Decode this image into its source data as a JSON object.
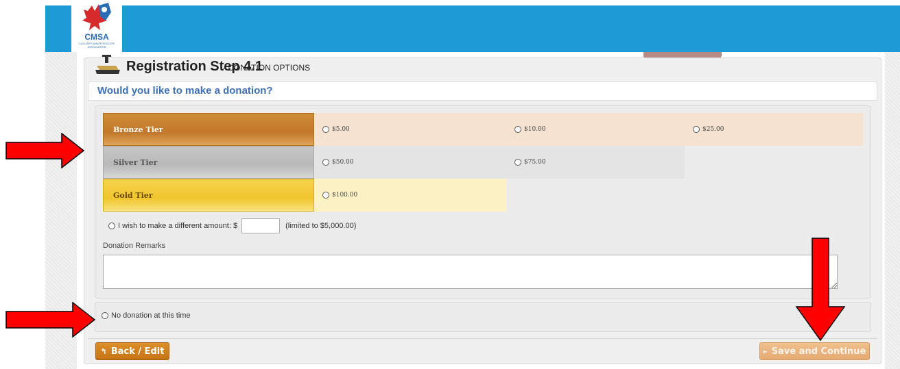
{
  "logo": {
    "name": "CMSA",
    "tagline": "CALGARY MINOR SOCCER ASSOCIATION"
  },
  "step": {
    "title": "Registration Step 4.1",
    "subtitle": "- DONATION OPTIONS"
  },
  "question": "Would you like to make a donation?",
  "tiers": {
    "bronze": {
      "label": "Bronze Tier",
      "options": [
        "$5.00",
        "$10.00",
        "$25.00"
      ]
    },
    "silver": {
      "label": "Silver Tier",
      "options": [
        "$50.00",
        "$75.00"
      ]
    },
    "gold": {
      "label": "Gold Tier",
      "options": [
        "$100.00"
      ]
    }
  },
  "different_amount": {
    "label": "I wish to make a different amount: $",
    "value": "",
    "limit_note": "(limited to $5,000.00)"
  },
  "remarks": {
    "label": "Donation Remarks",
    "value": ""
  },
  "no_donation_label": "No donation at this time",
  "buttons": {
    "back": "Back / Edit",
    "save": "Save and Continue"
  },
  "colors": {
    "header": "#1e9ad6",
    "bronze": "#c2782a",
    "silver": "#b9b9b9",
    "gold": "#f0c52e",
    "annotation_arrow": "#ff0000",
    "question_text": "#3d6fb5"
  }
}
